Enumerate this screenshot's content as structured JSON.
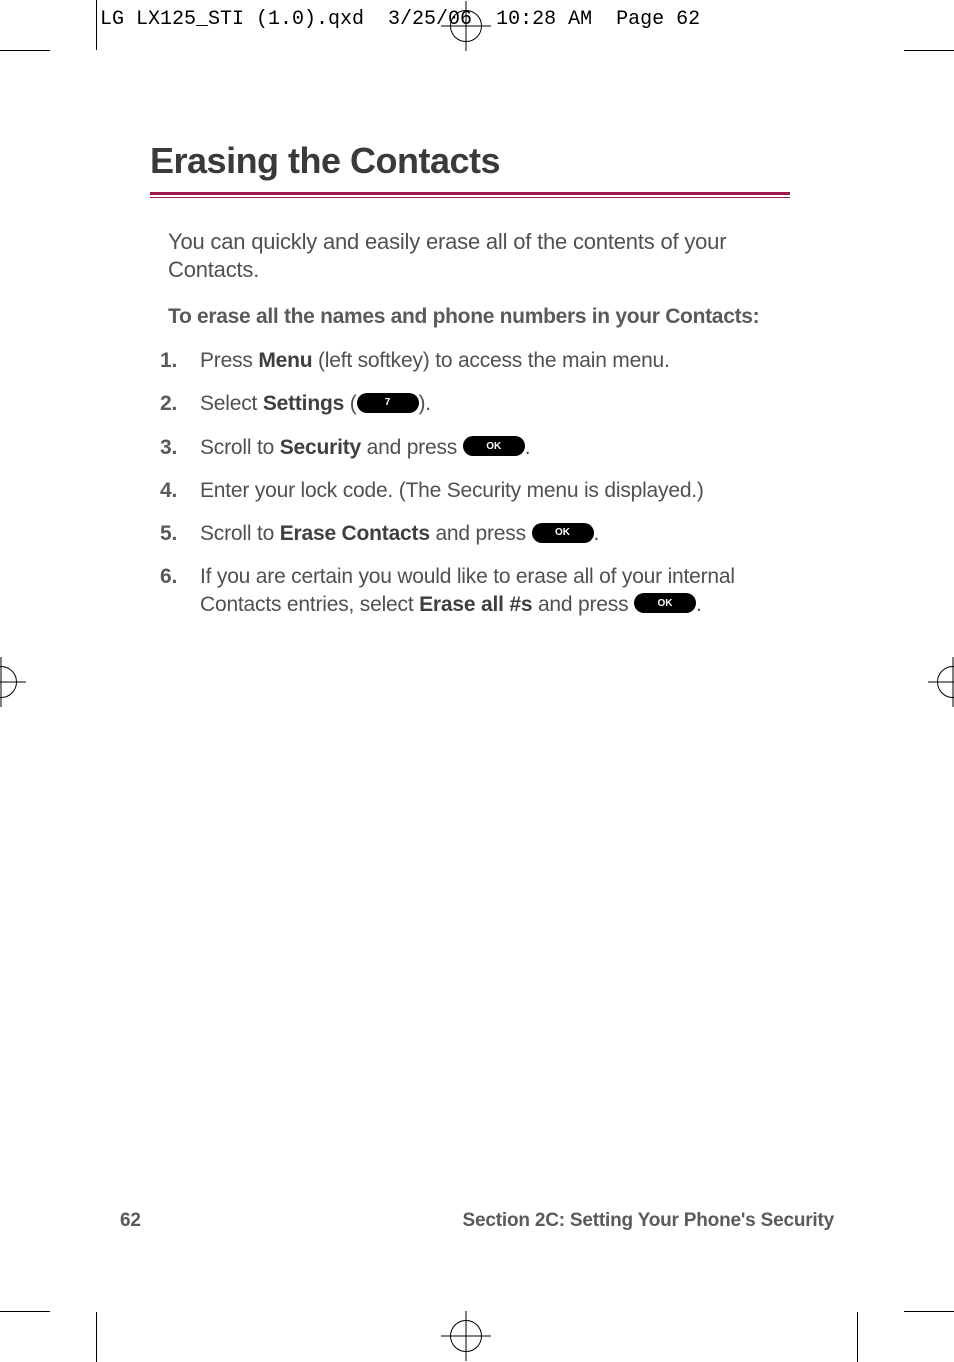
{
  "print_header": "LG LX125_STI (1.0).qxd  3/25/06  10:28 AM  Page 62",
  "title": "Erasing the Contacts",
  "intro": "You can quickly and easily erase all of the contents of your Contacts.",
  "subhead": "To erase all the names and phone numbers in your Contacts:",
  "steps": [
    {
      "num": "1.",
      "pre": "Press ",
      "bold1": "Menu",
      "mid": " (left softkey) to access the main menu.",
      "key": null,
      "post": ""
    },
    {
      "num": "2.",
      "pre": "Select ",
      "bold1": "Settings",
      "mid": " (",
      "key": "7",
      "post": ")."
    },
    {
      "num": "3.",
      "pre": "Scroll to ",
      "bold1": "Security",
      "mid": " and press ",
      "key": "OK",
      "post": "."
    },
    {
      "num": "4.",
      "pre": "Enter your lock code. (The Security menu is displayed.)",
      "bold1": "",
      "mid": "",
      "key": null,
      "post": ""
    },
    {
      "num": "5.",
      "pre": "Scroll to ",
      "bold1": "Erase Contacts",
      "mid": " and press ",
      "key": "OK",
      "post": "."
    },
    {
      "num": "6.",
      "pre": "If you are certain you would like to erase all of your internal Contacts entries, select ",
      "bold1": "Erase all #s",
      "mid": " and press ",
      "key": "OK",
      "post": "."
    }
  ],
  "footer": {
    "page_number": "62",
    "section": "Section 2C: Setting Your Phone's Security"
  }
}
